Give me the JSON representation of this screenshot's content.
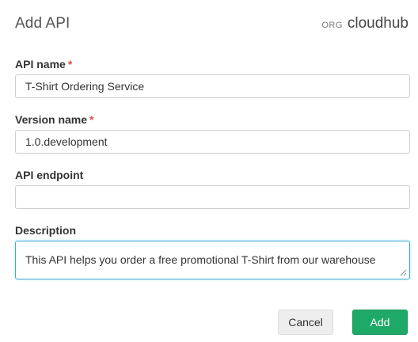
{
  "dialog": {
    "title": "Add API",
    "org_label": "ORG",
    "org_name": "cloudhub"
  },
  "fields": {
    "api_name": {
      "label": "API name",
      "required_mark": "*",
      "value": "T-Shirt Ordering Service"
    },
    "version_name": {
      "label": "Version name",
      "required_mark": "*",
      "value": "1.0.development"
    },
    "api_endpoint": {
      "label": "API endpoint",
      "value": ""
    },
    "description": {
      "label": "Description",
      "value": "This API helps you order a free promotional T-Shirt from our warehouse"
    }
  },
  "actions": {
    "cancel_label": "Cancel",
    "add_label": "Add"
  },
  "colors": {
    "required": "#d9534f",
    "primary": "#1fa968",
    "focus_border": "#3fa9d9"
  }
}
